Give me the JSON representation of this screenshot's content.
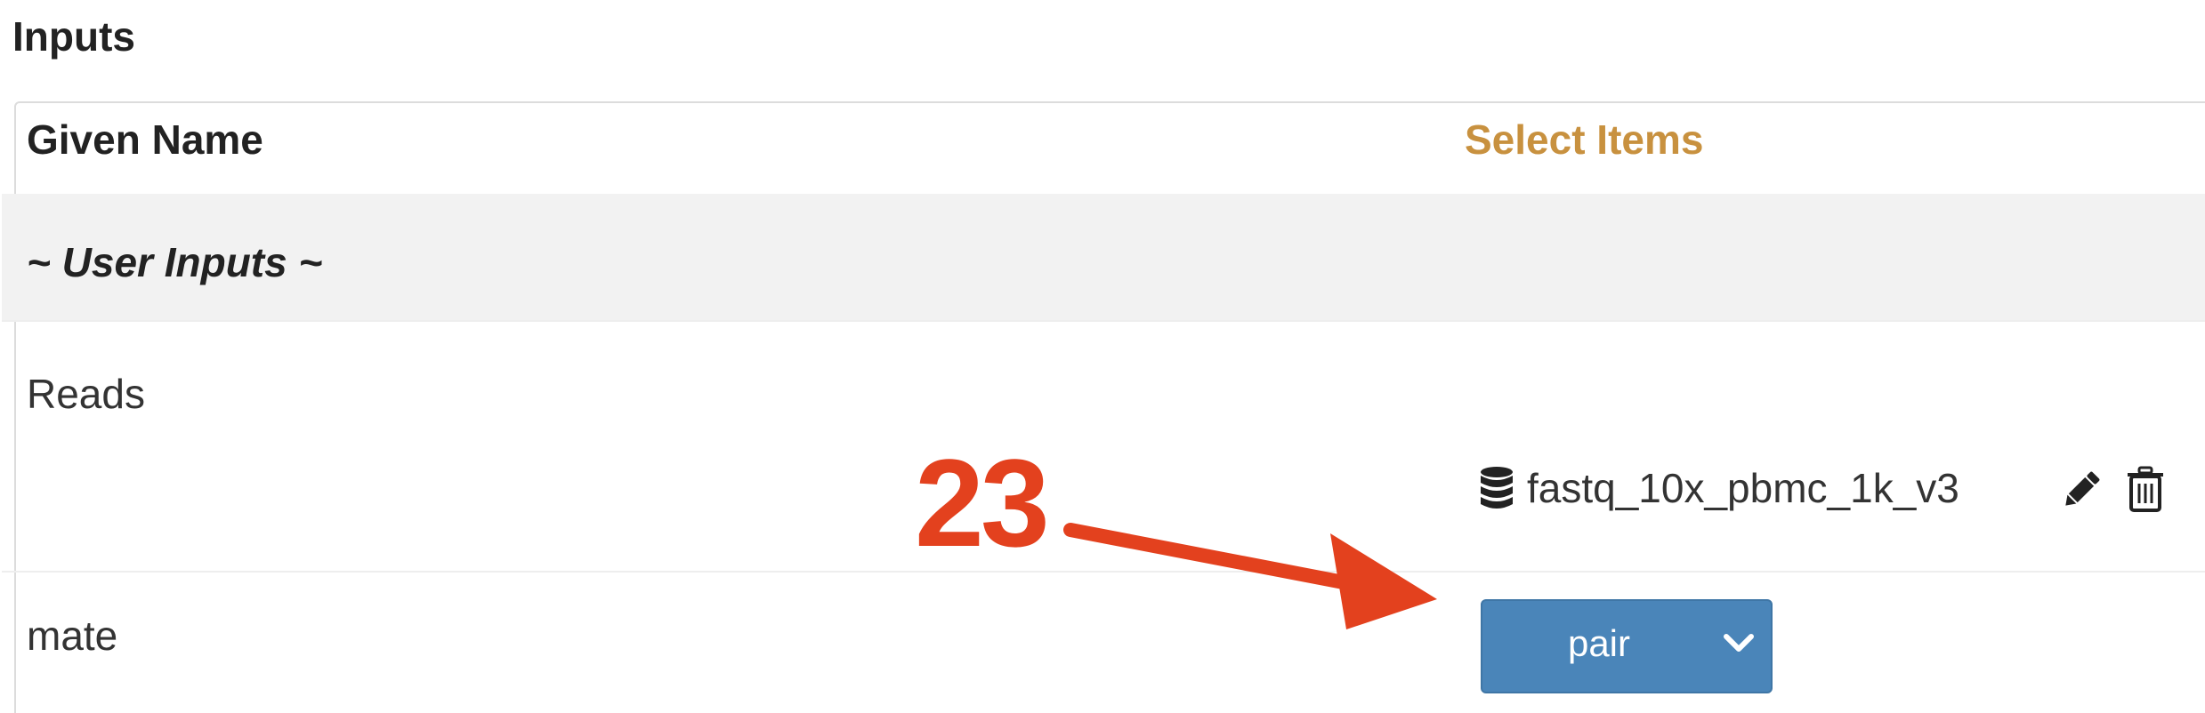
{
  "section": {
    "title": "Inputs"
  },
  "table": {
    "headers": {
      "given_name": "Given Name",
      "select_items": "Select Items"
    },
    "group_label": "~ User Inputs ~",
    "rows": [
      {
        "label": "Reads",
        "dataset": "fastq_10x_pbmc_1k_v3"
      },
      {
        "label": "mate",
        "select_value": "pair"
      }
    ]
  },
  "annotation": {
    "number": "23"
  },
  "colors": {
    "select_items_header": "#c8913f",
    "select_button": "#4a85b9",
    "annotation": "#e3411e",
    "group_row_bg": "#f2f2f2"
  },
  "icons": {
    "dataset": "database-icon",
    "edit": "pencil-icon",
    "delete": "trash-icon",
    "dropdown": "chevron-down-icon"
  }
}
